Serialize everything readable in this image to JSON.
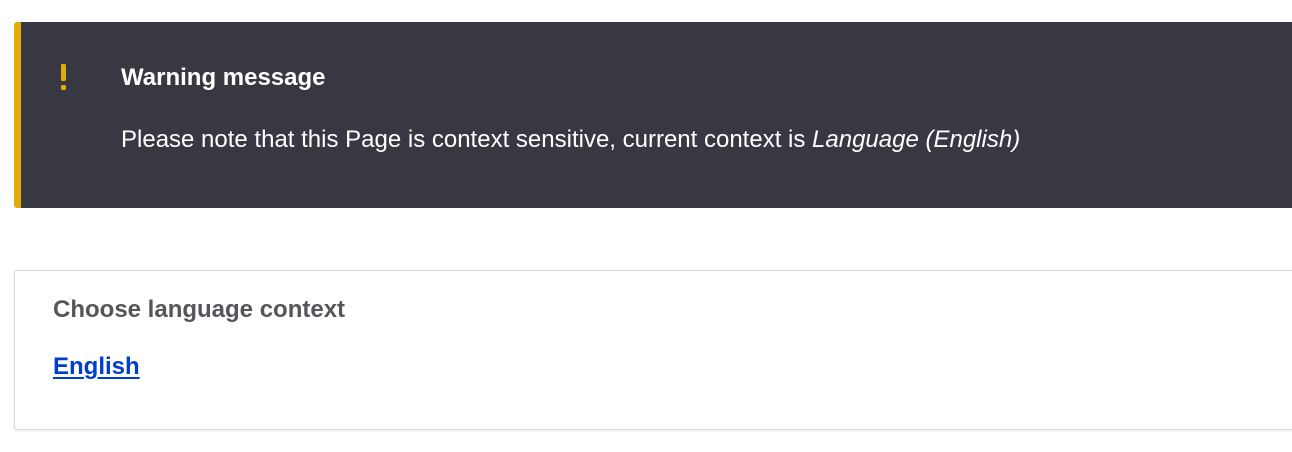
{
  "warning": {
    "icon": "exclamation-icon",
    "icon_color": "#e1ab0b",
    "background_color": "#383843",
    "title": "Warning message",
    "body_text": "Please note that this Page is context sensitive, current context is ",
    "body_context": "Language (English)"
  },
  "context_chooser": {
    "title": "Choose language context",
    "options": [
      {
        "label": "English"
      }
    ],
    "link_color": "#003ecc"
  }
}
